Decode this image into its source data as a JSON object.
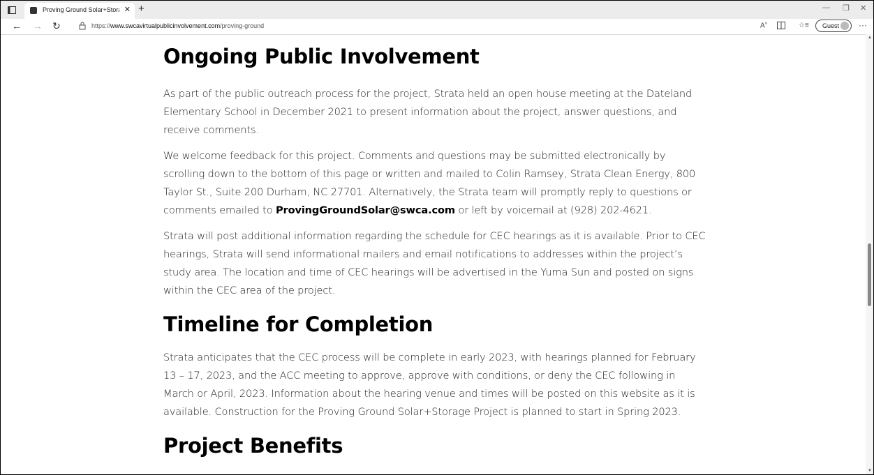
{
  "browser": {
    "tab_title": "Proving Ground Solar+Storage P",
    "tab_close": "✕",
    "new_tab": "+",
    "url_prefix": "https://",
    "url_host": "www.swcavirtualpublicinvolvement.com",
    "url_path": "/proving-ground",
    "profile_label": "Guest",
    "more": "···"
  },
  "article": {
    "h_ongoing": "Ongoing Public Involvement",
    "p_open_house": "As part of the public outreach process for the project, Strata held an open house meeting at the Dateland Elementary School in December 2021 to present information about the project, answer questions, and receive comments.",
    "p_feedback_before": "We welcome feedback for this project. Comments and questions may be submitted electronically by scrolling down to the bottom of this page or written and mailed to Colin Ramsey, Strata Clean Energy, 800 Taylor St., Suite 200 Durham, NC 27701. Alternatively, the Strata team will promptly reply to questions or comments emailed to ",
    "email": "ProvingGroundSolar@swca.com",
    "p_feedback_after": " or left by voicemail at (928) 202-4621.",
    "p_cec": "Strata will post additional information regarding the schedule for CEC hearings as it is available. Prior to CEC hearings, Strata will send informational mailers and email notifications to addresses within the project’s study area. The location and time of CEC hearings will be advertised in the Yuma Sun and posted on signs within the CEC area of the project.",
    "h_timeline": "Timeline for Completion",
    "p_timeline": "Strata anticipates that the CEC process will be complete in early 2023, with hearings planned for February 13 – 17, 2023, and the ACC meeting to approve, approve with conditions, or deny the CEC following in March or April, 2023. Information about the hearing venue and times will be posted on this website as it is available. Construction for the Proving Ground Solar+Storage Project is planned to start in Spring 2023.",
    "h_benefits": "Project Benefits"
  }
}
